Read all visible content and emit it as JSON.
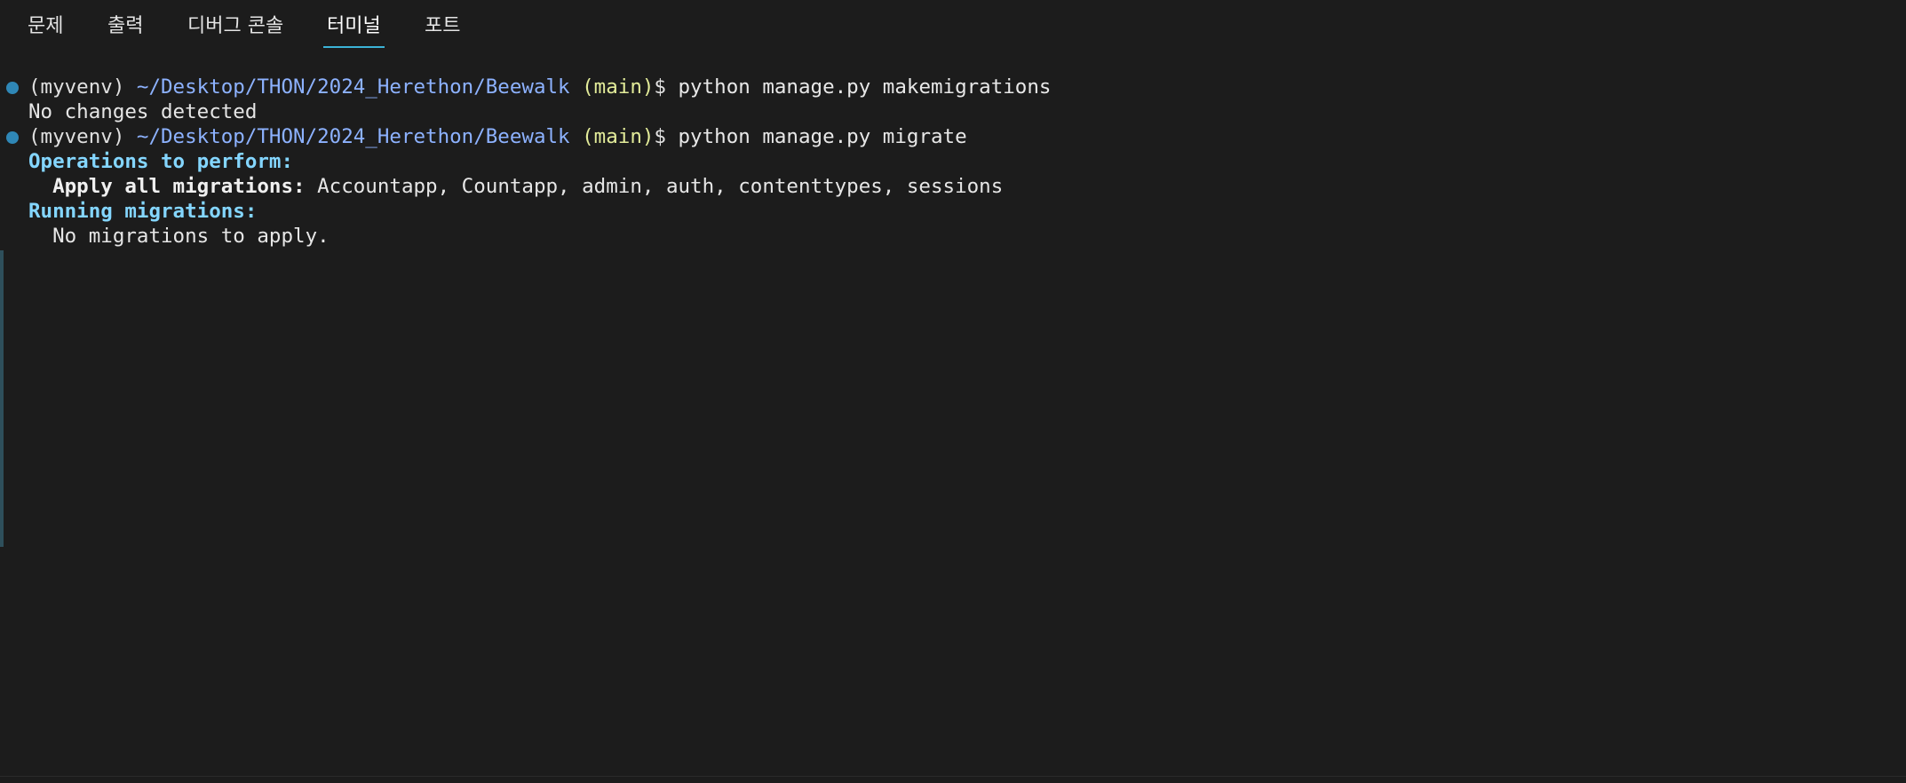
{
  "tabs": [
    {
      "label": "문제",
      "active": false
    },
    {
      "label": "출력",
      "active": false
    },
    {
      "label": "디버그 콘솔",
      "active": false
    },
    {
      "label": "터미널",
      "active": true
    },
    {
      "label": "포트",
      "active": false
    }
  ],
  "terminal": {
    "cmd1": {
      "env": "(myvenv)",
      "path": "~/Desktop/THON/2024_Herethon/Beewalk",
      "branch": "(main)",
      "dollar": "$",
      "command": "python manage.py makemigrations"
    },
    "out1": "No changes detected",
    "cmd2": {
      "env": "(myvenv)",
      "path": "~/Desktop/THON/2024_Herethon/Beewalk",
      "branch": "(main)",
      "dollar": "$",
      "command": "python manage.py migrate"
    },
    "ops_header": "Operations to perform:",
    "apply_label": "Apply all migrations:",
    "apply_value": "Accountapp, Countapp, admin, auth, contenttypes, sessions",
    "running_header": "Running migrations:",
    "no_migrations": "No migrations to apply."
  },
  "colors": {
    "background": "#1c1c1c",
    "tab_active_underline": "#3bb3d6",
    "prompt_path": "#8db2ff",
    "prompt_branch": "#e3ec9a",
    "header_text": "#84d6ff",
    "command_decoration": "#2f87b6"
  },
  "icons": [
    "command-decoration-circle-icon"
  ]
}
